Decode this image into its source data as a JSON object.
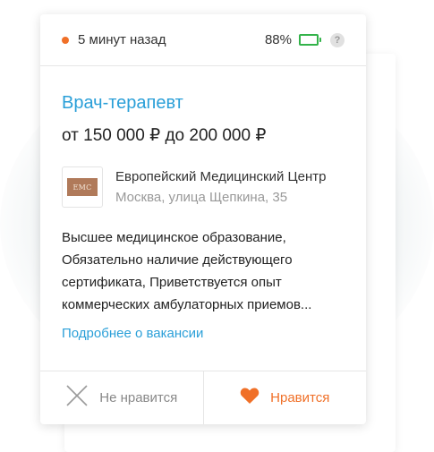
{
  "header": {
    "time_ago": "5 минут назад",
    "battery_percent": "88%",
    "battery_level": 0.88,
    "help_label": "?"
  },
  "vacancy": {
    "title": "Врач-терапевт",
    "salary": "от 150 000 ₽ до 200 000 ₽",
    "employer": {
      "logo_text": "EMC",
      "name": "Европейский Медицинский Центр",
      "address": "Москва, улица Щепкина, 35"
    },
    "description_lines": [
      "Высшее медицинское образование,",
      "Обязательно наличие действующего",
      "сертификата, Приветствуется опыт",
      "коммерческих амбулаторных приемов..."
    ],
    "more_link": "Подробнее о вакансии"
  },
  "actions": {
    "dislike_label": "Не нравится",
    "like_label": "Нравится"
  },
  "colors": {
    "accent": "#2a9fd8",
    "like": "#f07028",
    "battery": "#33b34a",
    "status_dot": "#f07028"
  },
  "icons": {
    "dislike": "close-icon",
    "like": "heart-icon",
    "battery": "battery-icon",
    "help": "question-icon"
  }
}
